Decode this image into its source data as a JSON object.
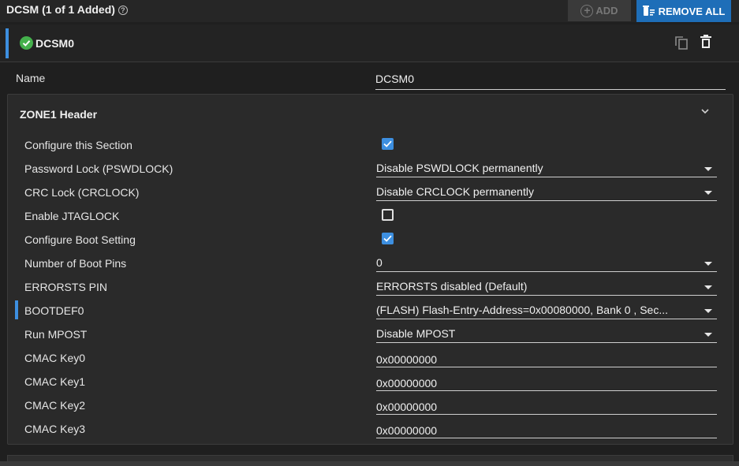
{
  "header": {
    "title": "DCSM (1 of 1 Added)",
    "help_icon": "help-circle-icon",
    "add_label": "ADD",
    "remove_all_label": "REMOVE ALL"
  },
  "instance": {
    "name": "DCSM0",
    "status_icon": "check-circle-icon",
    "status_color": "#44b04c"
  },
  "name_field": {
    "label": "Name",
    "value": "DCSM0"
  },
  "zone": {
    "title": "ZONE1 Header",
    "rows": [
      {
        "label": "Configure this Section",
        "type": "checkbox",
        "checked": true
      },
      {
        "label": "Password Lock (PSWDLOCK)",
        "type": "select",
        "value": "Disable PSWDLOCK permanently"
      },
      {
        "label": "CRC Lock (CRCLOCK)",
        "type": "select",
        "value": "Disable CRCLOCK permanently"
      },
      {
        "label": "Enable JTAGLOCK",
        "type": "checkbox",
        "checked": false
      },
      {
        "label": "Configure Boot Setting",
        "type": "checkbox",
        "checked": true
      },
      {
        "label": "Number of Boot Pins",
        "type": "select",
        "value": "0"
      },
      {
        "label": "ERRORSTS PIN",
        "type": "select",
        "value": "ERRORSTS disabled (Default)"
      },
      {
        "label": "BOOTDEF0",
        "type": "select",
        "value": "(FLASH) Flash-Entry-Address=0x00080000, Bank 0 , Sec...",
        "highlighted": true
      },
      {
        "label": "Run MPOST",
        "type": "select",
        "value": "Disable MPOST"
      },
      {
        "label": "CMAC Key0",
        "type": "text",
        "value": "0x00000000"
      },
      {
        "label": "CMAC Key1",
        "type": "text",
        "value": "0x00000000"
      },
      {
        "label": "CMAC Key2",
        "type": "text",
        "value": "0x00000000"
      },
      {
        "label": "CMAC Key3",
        "type": "text",
        "value": "0x00000000"
      }
    ]
  },
  "colors": {
    "accent": "#3d8fe0",
    "primary_button": "#1e6eb8",
    "background": "#1f1f1f",
    "panel": "#2a2a2a"
  }
}
